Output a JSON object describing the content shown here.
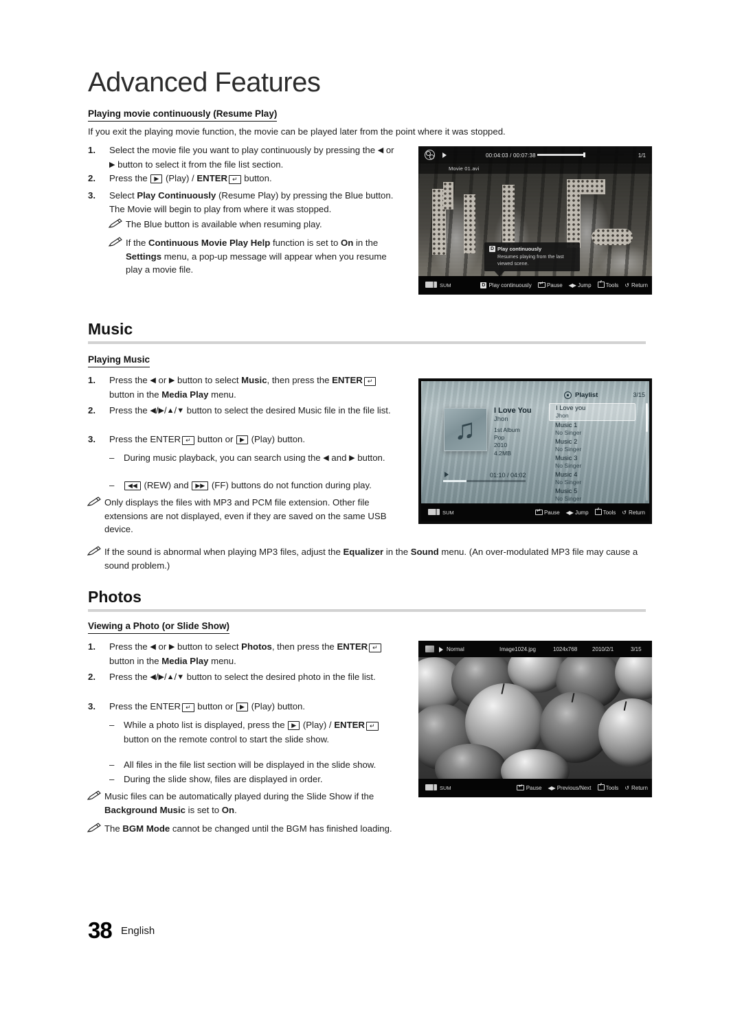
{
  "chapter": {
    "title": "Advanced Features"
  },
  "resume": {
    "heading": "Playing movie continuously (Resume Play)",
    "intro": "If you exit the playing movie function, the movie can be played later from the point where it was stopped.",
    "steps": [
      {
        "num": "1.",
        "html": "Select the movie file you want to play continuously by pressing the <span class=\"arrow\">&#9664;</span> or <span class=\"arrow\">&#9654;</span> button to select it from the file list section."
      },
      {
        "num": "2.",
        "html": "Press the <span class=\"key\">&#9654;</span> (Play) / <b>ENTER</b><span class=\"ent\"><span class=\"key\">&#8629;</span></span> button."
      },
      {
        "num": "3.",
        "html": "Select <b>Play Continuously</b> (Resume Play) by pressing the Blue button. The Movie will begin to play from where it was stopped."
      }
    ],
    "notes": [
      {
        "html": "The Blue button is available when resuming play."
      },
      {
        "html": "If the <b>Continuous Movie Play Help</b> function is set to <b>On</b> in the <b>Settings</b> menu, a pop-up message will appear when you resume play a movie file."
      }
    ]
  },
  "music_section": {
    "title": "Music",
    "sub_heading": "Playing Music",
    "steps": [
      {
        "num": "1.",
        "html": "Press the <span class=\"arrow\">&#9664;</span> or <span class=\"arrow\">&#9654;</span> button to select <b>Music</b>, then press the <b>ENTER</b><span class=\"ent\"><span class=\"key\">&#8629;</span></span> button in the <b>Media Play</b> menu."
      },
      {
        "num": "2.",
        "html": "Press the <span class=\"arrow\">&#9664;</span>/<span class=\"arrow\">&#9654;</span>/<span class=\"arrow\">&#9650;</span>/<span class=\"arrow\">&#9660;</span> button to select the desired Music file in the file list."
      },
      {
        "num": "3.",
        "html": "Press the ENTER<span class=\"ent\"><span class=\"key\">&#8629;</span></span> button or <span class=\"key\">&#9654;</span> (Play) button."
      }
    ],
    "dashes": [
      {
        "html": "During music playback, you can search using the <span class=\"arrow\">&#9664;</span> and <span class=\"arrow\">&#9654;</span> button."
      },
      {
        "html": "<span class=\"key\">&#9664;&#9664;</span> (REW) and <span class=\"key\">&#9654;&#9654;</span> (FF) buttons do not function during play."
      }
    ],
    "notes": [
      {
        "html": "Only displays the files with MP3 and PCM file extension. Other file extensions are not displayed, even if they are saved on the same USB device."
      },
      {
        "html": "If the sound is abnormal when playing MP3 files, adjust the <b>Equalizer</b> in the <b>Sound</b> menu. (An over-modulated MP3 file may cause a sound problem.)"
      }
    ]
  },
  "photos_section": {
    "title": "Photos",
    "sub_heading": "Viewing a Photo (or Slide Show)",
    "steps": [
      {
        "num": "1.",
        "html": "Press the <span class=\"arrow\">&#9664;</span> or <span class=\"arrow\">&#9654;</span> button to select <b>Photos</b>, then press the <b>ENTER</b><span class=\"ent\"><span class=\"key\">&#8629;</span></span> button in the <b>Media Play</b> menu."
      },
      {
        "num": "2.",
        "html": "Press the <span class=\"arrow\">&#9664;</span>/<span class=\"arrow\">&#9654;</span>/<span class=\"arrow\">&#9650;</span>/<span class=\"arrow\">&#9660;</span> button to select the desired photo in the file list."
      },
      {
        "num": "3.",
        "html": "Press the ENTER<span class=\"ent\"><span class=\"key\">&#8629;</span></span> button or <span class=\"key\">&#9654;</span> (Play) button."
      }
    ],
    "dashes": [
      {
        "html": "While a photo list is displayed, press the <span class=\"key\">&#9654;</span> (Play) / <b>ENTER</b><span class=\"ent\"><span class=\"key\">&#8629;</span></span> button on the remote control to start the slide show."
      },
      {
        "html": "All files in the file list section will be displayed in the slide show."
      },
      {
        "html": "During the slide show, files are displayed in order."
      }
    ],
    "notes": [
      {
        "html": "Music files can be automatically played during the Slide Show if the <b>Background Music</b> is set to <b>On</b>."
      },
      {
        "html": "The <b>BGM Mode</b> cannot be changed until the BGM has finished loading."
      }
    ]
  },
  "movie_screen": {
    "file_name": "Movie 01.avi",
    "time": "00:04:03 / 00:07:38",
    "page_index": "1/1",
    "progress_percent": 53,
    "tooltip": {
      "badge": "D",
      "title": "Play continuously",
      "body": "Resumes playing from the last viewed scene."
    },
    "device_label": "SUM",
    "buttons": [
      {
        "badge": "D",
        "label": "Play continuously"
      },
      {
        "glyph": "enter",
        "label": "Pause"
      },
      {
        "glyph": "lr",
        "label": "Jump"
      },
      {
        "glyph": "tools",
        "label": "Tools"
      },
      {
        "glyph": "return",
        "label": "Return"
      }
    ]
  },
  "music_screen": {
    "track_title": "I Love You",
    "track_artist": "Jhon",
    "meta": [
      "1st Album",
      "Pop",
      "2010",
      "4.2MB"
    ],
    "time": "01:10 / 04:02",
    "progress_percent": 28,
    "playlist_label": "Playlist",
    "playlist_count": "3/15",
    "playlist": [
      {
        "title": "I Love you",
        "subtitle": "Jhon",
        "selected": true
      },
      {
        "title": "Music 1",
        "subtitle": "No Singer",
        "selected": false
      },
      {
        "title": "Music 2",
        "subtitle": "No Singer",
        "selected": false
      },
      {
        "title": "Music 3",
        "subtitle": "No Singer",
        "selected": false
      },
      {
        "title": "Music 4",
        "subtitle": "No Singer",
        "selected": false
      },
      {
        "title": "Music 5",
        "subtitle": "No Singer",
        "selected": false
      }
    ],
    "device_label": "SUM",
    "buttons": [
      {
        "glyph": "enter",
        "label": "Pause"
      },
      {
        "glyph": "lr",
        "label": "Jump"
      },
      {
        "glyph": "tools",
        "label": "Tools"
      },
      {
        "glyph": "return",
        "label": "Return"
      }
    ]
  },
  "photo_screen": {
    "mode": "Normal",
    "file_name": "Image1024.jpg",
    "resolution": "1024x768",
    "date": "2010/2/1",
    "page_index": "3/15",
    "device_label": "SUM",
    "buttons": [
      {
        "glyph": "enter",
        "label": "Pause"
      },
      {
        "glyph": "lr",
        "label": "Previous/Next"
      },
      {
        "glyph": "tools",
        "label": "Tools"
      },
      {
        "glyph": "return",
        "label": "Return"
      }
    ]
  },
  "footer": {
    "page_number": "38",
    "language": "English"
  }
}
